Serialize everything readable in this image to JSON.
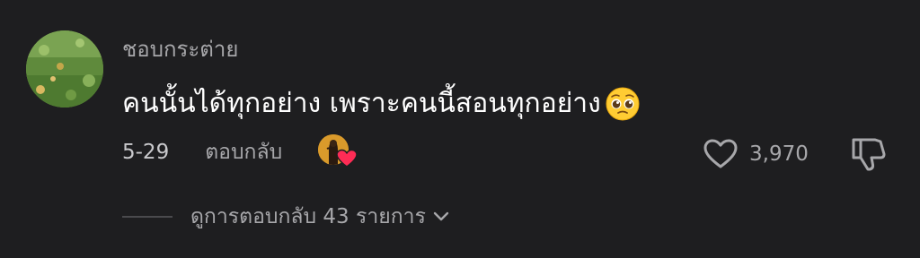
{
  "comment": {
    "username": "ชอบกระต่าย",
    "text": "คนนั้นได้ทุกอย่าง เพราะคนนี้สอนทุกอย่าง",
    "emoji": "pleading-face",
    "date": "5-29",
    "reply_label": "ตอบกลับ",
    "creator_liked": true,
    "like_count": "3,970",
    "view_replies_label": "ดูการตอบกลับ 43 รายการ"
  },
  "colors": {
    "background": "#1e1e20",
    "primary_text": "#ffffff",
    "secondary_text": "#a7a7aa",
    "heart_badge": "#fe2c55"
  },
  "icons": {
    "like": "heart-outline-icon",
    "dislike": "thumbs-down-icon",
    "expand": "chevron-down-icon",
    "creator_badge": "heart-filled-icon"
  }
}
